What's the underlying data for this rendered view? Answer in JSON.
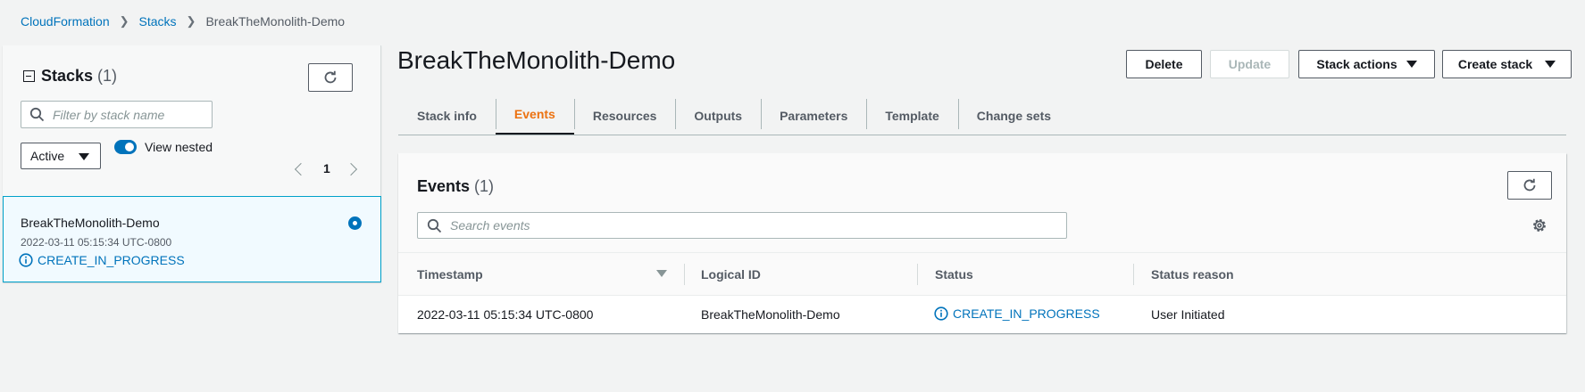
{
  "breadcrumb": {
    "root": "CloudFormation",
    "stacks": "Stacks",
    "current": "BreakTheMonolith-Demo"
  },
  "sidebar": {
    "title": "Stacks",
    "count": "(1)",
    "filter_placeholder": "Filter by stack name",
    "status_filter": "Active",
    "view_nested_label": "View nested",
    "view_nested_on": true,
    "page": "1",
    "stack": {
      "name": "BreakTheMonolith-Demo",
      "created": "2022-03-11 05:15:34 UTC-0800",
      "status": "CREATE_IN_PROGRESS"
    }
  },
  "main": {
    "title": "BreakTheMonolith-Demo",
    "actions": {
      "delete": "Delete",
      "update": "Update",
      "stack_actions": "Stack actions",
      "create_stack": "Create stack"
    },
    "tabs": [
      "Stack info",
      "Events",
      "Resources",
      "Outputs",
      "Parameters",
      "Template",
      "Change sets"
    ],
    "active_tab": "Events"
  },
  "events": {
    "title": "Events",
    "count": "(1)",
    "search_placeholder": "Search events",
    "columns": [
      "Timestamp",
      "Logical ID",
      "Status",
      "Status reason"
    ],
    "rows": [
      {
        "timestamp": "2022-03-11 05:15:34 UTC-0800",
        "logical_id": "BreakTheMonolith-Demo",
        "status": "CREATE_IN_PROGRESS",
        "reason": "User Initiated"
      }
    ]
  },
  "colors": {
    "link": "#0073bb",
    "active_tab": "#ec7211",
    "selected_card_bg": "#f1faff"
  }
}
